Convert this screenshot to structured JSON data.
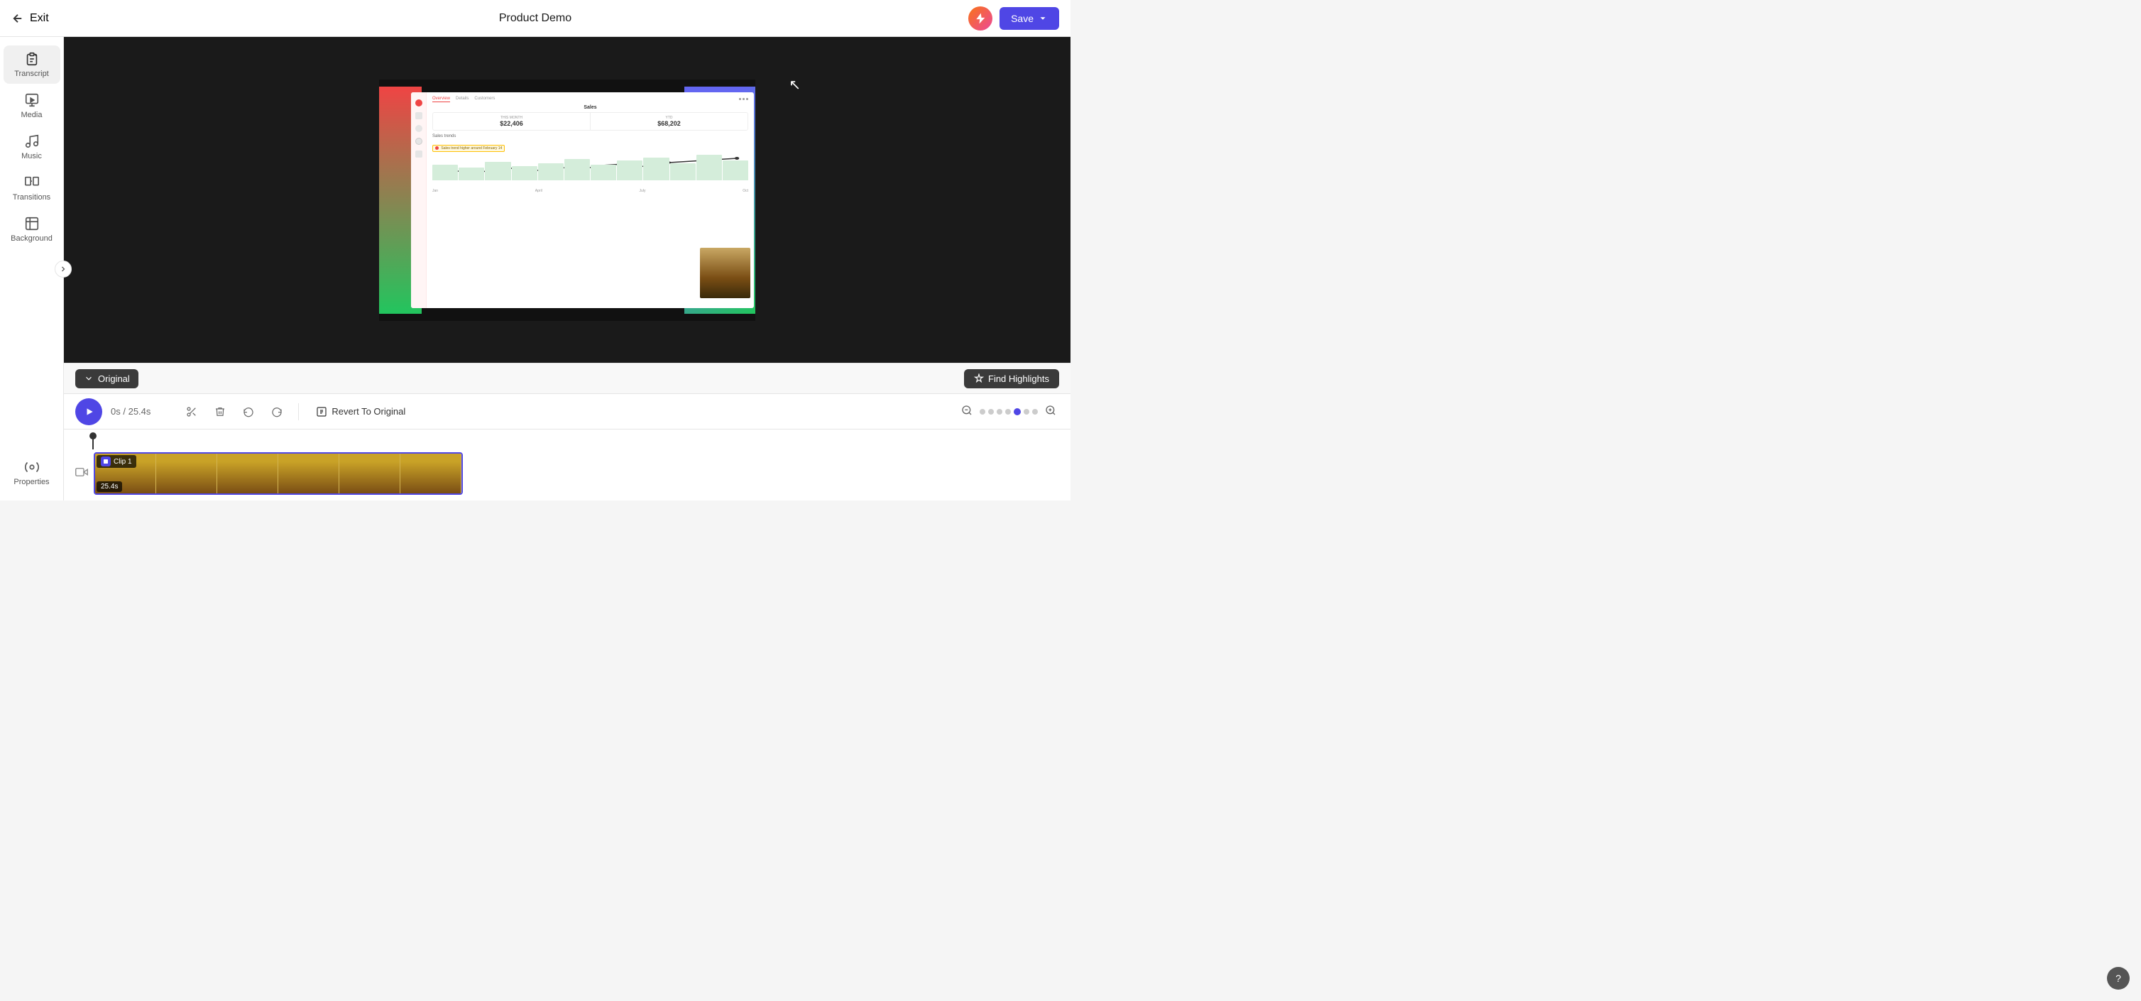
{
  "app": {
    "title": "Product Demo",
    "exit_label": "Exit",
    "save_label": "Save"
  },
  "sidebar": {
    "items": [
      {
        "id": "transcript",
        "label": "Transcript",
        "active": true
      },
      {
        "id": "media",
        "label": "Media",
        "active": false
      },
      {
        "id": "music",
        "label": "Music",
        "active": false
      },
      {
        "id": "transitions",
        "label": "Transitions",
        "active": false
      },
      {
        "id": "background",
        "label": "Background",
        "active": false
      },
      {
        "id": "properties",
        "label": "Properties",
        "active": false
      }
    ]
  },
  "timeline_header": {
    "original_label": "Original",
    "find_highlights_label": "Find Highlights"
  },
  "toolbar": {
    "time_current": "0s",
    "time_total": "25.4s",
    "time_separator": "/",
    "revert_label": "Revert To Original"
  },
  "clip": {
    "label": "Clip 1",
    "duration": "25.4s"
  },
  "dashboard_mock": {
    "nav_items": [
      "Overview",
      "Details",
      "Customers"
    ],
    "chart_title": "Sales",
    "metric1_label": "THIS MONTH",
    "metric1_value": "$22,406",
    "metric2_label": "YTD",
    "metric2_value": "$68,202",
    "chart_label": "Sales trends",
    "chart_tag": "Sales trend higher around February 14",
    "x_labels": [
      "Jan",
      "April",
      "July",
      "Oct"
    ]
  },
  "zoom": {
    "dots": [
      1,
      2,
      3,
      4,
      5,
      6,
      7
    ],
    "active_dot": 5
  },
  "help": {
    "label": "?"
  }
}
